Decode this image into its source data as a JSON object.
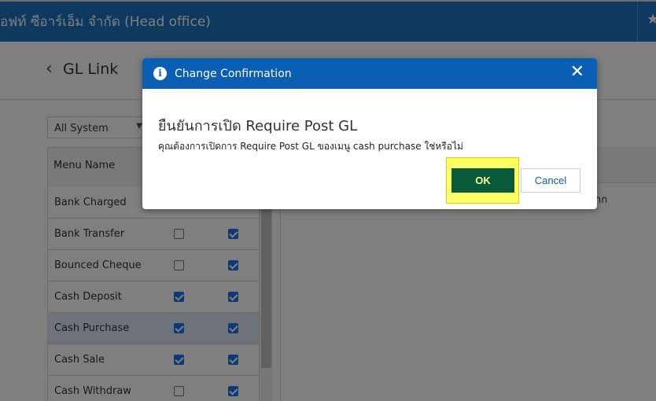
{
  "topbar": {
    "company": "อฟท์ ซีอาร์เอ็ม จำกัด (Head office)",
    "star_icon": "star-icon"
  },
  "page": {
    "back_icon": "chevron-left-icon",
    "title": "GL Link"
  },
  "filter": {
    "selected": "All System"
  },
  "table": {
    "header": {
      "menu_name": "Menu Name"
    },
    "rows": [
      {
        "name": "Bank Charged",
        "col1": null,
        "col2": null
      },
      {
        "name": "Bank Transfer",
        "col1": false,
        "col2": true
      },
      {
        "name": "Bounced Cheque",
        "col1": false,
        "col2": true
      },
      {
        "name": "Cash Deposit",
        "col1": true,
        "col2": true
      },
      {
        "name": "Cash Purchase",
        "col1": true,
        "col2": true,
        "selected": true
      },
      {
        "name": "Cash Sale",
        "col1": true,
        "col2": true
      },
      {
        "name": "Cash Withdraw",
        "col1": false,
        "col2": true
      }
    ]
  },
  "right_panel": {
    "cell_text": "าก"
  },
  "modal": {
    "title": "Change Confirmation",
    "heading": "ยืนยันการเปิด Require Post GL",
    "message": "คุณต้องการเปิดการ Require Post GL ของเมนู cash purchase ใช่หรือไม่",
    "ok_label": "OK",
    "cancel_label": "Cancel"
  },
  "colors": {
    "topbar": "#1e73be",
    "modal_header": "#0a5fb4",
    "ok_button": "#0c5a3c",
    "ok_text": "#ffff99",
    "highlight": "#ffff66",
    "checkbox_checked": "#1a73e8"
  }
}
